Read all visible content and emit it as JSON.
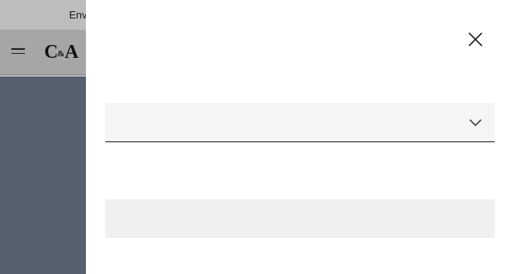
{
  "announcement": {
    "text": "Env"
  },
  "header": {
    "logo": {
      "text_main": "C",
      "text_amp": "&",
      "text_end": "A"
    }
  },
  "drawer": {
    "select": {
      "value": ""
    },
    "submit_label": ""
  },
  "icons": {
    "menu": "hamburger-menu-icon",
    "close": "close-icon",
    "select_arrow": "chevron-down-icon"
  },
  "colors": {
    "announcement_bg": "#bdbdbd",
    "header_bg": "#a6a6a6",
    "hero_bg": "#56606f",
    "drawer_bg": "#ffffff",
    "field_bg": "#f5f5f5",
    "button_bg": "#f0f0f0"
  }
}
